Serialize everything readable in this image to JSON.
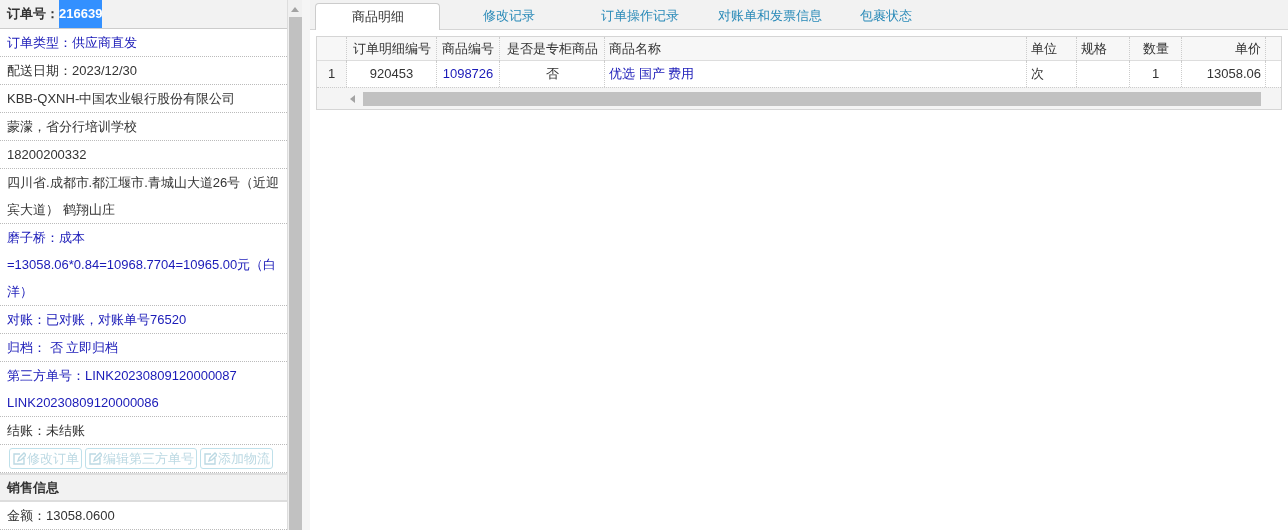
{
  "order_panel": {
    "label": "订单号：",
    "order_number": "216639",
    "number_selected": true,
    "rows": [
      {
        "text": "订单类型：供应商直发",
        "kind": "link"
      },
      {
        "text": "配送日期：2023/12/30",
        "kind": "text"
      },
      {
        "text": "KBB-QXNH-中国农业银行股份有限公司",
        "kind": "text"
      },
      {
        "text": "蒙濛，省分行培训学校",
        "kind": "text"
      },
      {
        "text": "18200200332",
        "kind": "text"
      },
      {
        "text": "四川省.成都市.都江堰市.青城山大道26号（近迎宾大道） 鹤翔山庄",
        "kind": "text"
      },
      {
        "text": "磨子桥：成本=13058.06*0.84=10968.7704=10965.00元（白洋）",
        "kind": "link"
      },
      {
        "text": "对账：已对账，对账单号76520",
        "kind": "link"
      },
      {
        "text": "归档： 否 立即归档",
        "kind": "link"
      },
      {
        "text": "第三方单号：LINK20230809120000087 LINK20230809120000086",
        "kind": "link"
      },
      {
        "text": "结账：未结账",
        "kind": "text"
      }
    ],
    "buttons": [
      {
        "label": "修改订单",
        "disabled": true
      },
      {
        "label": "编辑第三方单号",
        "disabled": true
      },
      {
        "label": "添加物流",
        "disabled": true
      }
    ],
    "sales_header": "销售信息",
    "sales_rows": [
      {
        "text": "金额：13058.0600"
      }
    ]
  },
  "tabs": [
    {
      "label": "商品明细",
      "selected": true
    },
    {
      "label": "修改记录",
      "selected": false
    },
    {
      "label": "订单操作记录",
      "selected": false
    },
    {
      "label": "对账单和发票信息",
      "selected": false
    },
    {
      "label": "包裹状态",
      "selected": false
    }
  ],
  "table": {
    "columns": [
      "订单明细编号",
      "商品编号",
      "是否是专柜商品",
      "商品名称",
      "单位",
      "规格",
      "数量",
      "单价"
    ],
    "rows": [
      {
        "row_number": "1",
        "cells": [
          "920453",
          "1098726",
          "否",
          "优选 国产 费用",
          "次",
          "",
          "1",
          "13058.06"
        ]
      }
    ]
  }
}
